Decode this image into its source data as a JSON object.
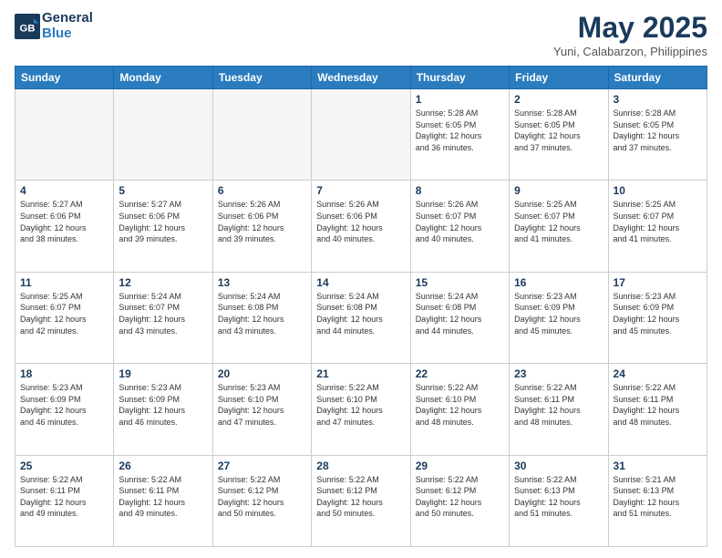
{
  "header": {
    "logo_line1": "General",
    "logo_line2": "Blue",
    "title": "May 2025",
    "subtitle": "Yuni, Calabarzon, Philippines"
  },
  "days_of_week": [
    "Sunday",
    "Monday",
    "Tuesday",
    "Wednesday",
    "Thursday",
    "Friday",
    "Saturday"
  ],
  "weeks": [
    [
      {
        "day": "",
        "info": ""
      },
      {
        "day": "",
        "info": ""
      },
      {
        "day": "",
        "info": ""
      },
      {
        "day": "",
        "info": ""
      },
      {
        "day": "1",
        "info": "Sunrise: 5:28 AM\nSunset: 6:05 PM\nDaylight: 12 hours\nand 36 minutes."
      },
      {
        "day": "2",
        "info": "Sunrise: 5:28 AM\nSunset: 6:05 PM\nDaylight: 12 hours\nand 37 minutes."
      },
      {
        "day": "3",
        "info": "Sunrise: 5:28 AM\nSunset: 6:05 PM\nDaylight: 12 hours\nand 37 minutes."
      }
    ],
    [
      {
        "day": "4",
        "info": "Sunrise: 5:27 AM\nSunset: 6:06 PM\nDaylight: 12 hours\nand 38 minutes."
      },
      {
        "day": "5",
        "info": "Sunrise: 5:27 AM\nSunset: 6:06 PM\nDaylight: 12 hours\nand 39 minutes."
      },
      {
        "day": "6",
        "info": "Sunrise: 5:26 AM\nSunset: 6:06 PM\nDaylight: 12 hours\nand 39 minutes."
      },
      {
        "day": "7",
        "info": "Sunrise: 5:26 AM\nSunset: 6:06 PM\nDaylight: 12 hours\nand 40 minutes."
      },
      {
        "day": "8",
        "info": "Sunrise: 5:26 AM\nSunset: 6:07 PM\nDaylight: 12 hours\nand 40 minutes."
      },
      {
        "day": "9",
        "info": "Sunrise: 5:25 AM\nSunset: 6:07 PM\nDaylight: 12 hours\nand 41 minutes."
      },
      {
        "day": "10",
        "info": "Sunrise: 5:25 AM\nSunset: 6:07 PM\nDaylight: 12 hours\nand 41 minutes."
      }
    ],
    [
      {
        "day": "11",
        "info": "Sunrise: 5:25 AM\nSunset: 6:07 PM\nDaylight: 12 hours\nand 42 minutes."
      },
      {
        "day": "12",
        "info": "Sunrise: 5:24 AM\nSunset: 6:07 PM\nDaylight: 12 hours\nand 43 minutes."
      },
      {
        "day": "13",
        "info": "Sunrise: 5:24 AM\nSunset: 6:08 PM\nDaylight: 12 hours\nand 43 minutes."
      },
      {
        "day": "14",
        "info": "Sunrise: 5:24 AM\nSunset: 6:08 PM\nDaylight: 12 hours\nand 44 minutes."
      },
      {
        "day": "15",
        "info": "Sunrise: 5:24 AM\nSunset: 6:08 PM\nDaylight: 12 hours\nand 44 minutes."
      },
      {
        "day": "16",
        "info": "Sunrise: 5:23 AM\nSunset: 6:09 PM\nDaylight: 12 hours\nand 45 minutes."
      },
      {
        "day": "17",
        "info": "Sunrise: 5:23 AM\nSunset: 6:09 PM\nDaylight: 12 hours\nand 45 minutes."
      }
    ],
    [
      {
        "day": "18",
        "info": "Sunrise: 5:23 AM\nSunset: 6:09 PM\nDaylight: 12 hours\nand 46 minutes."
      },
      {
        "day": "19",
        "info": "Sunrise: 5:23 AM\nSunset: 6:09 PM\nDaylight: 12 hours\nand 46 minutes."
      },
      {
        "day": "20",
        "info": "Sunrise: 5:23 AM\nSunset: 6:10 PM\nDaylight: 12 hours\nand 47 minutes."
      },
      {
        "day": "21",
        "info": "Sunrise: 5:22 AM\nSunset: 6:10 PM\nDaylight: 12 hours\nand 47 minutes."
      },
      {
        "day": "22",
        "info": "Sunrise: 5:22 AM\nSunset: 6:10 PM\nDaylight: 12 hours\nand 48 minutes."
      },
      {
        "day": "23",
        "info": "Sunrise: 5:22 AM\nSunset: 6:11 PM\nDaylight: 12 hours\nand 48 minutes."
      },
      {
        "day": "24",
        "info": "Sunrise: 5:22 AM\nSunset: 6:11 PM\nDaylight: 12 hours\nand 48 minutes."
      }
    ],
    [
      {
        "day": "25",
        "info": "Sunrise: 5:22 AM\nSunset: 6:11 PM\nDaylight: 12 hours\nand 49 minutes."
      },
      {
        "day": "26",
        "info": "Sunrise: 5:22 AM\nSunset: 6:11 PM\nDaylight: 12 hours\nand 49 minutes."
      },
      {
        "day": "27",
        "info": "Sunrise: 5:22 AM\nSunset: 6:12 PM\nDaylight: 12 hours\nand 50 minutes."
      },
      {
        "day": "28",
        "info": "Sunrise: 5:22 AM\nSunset: 6:12 PM\nDaylight: 12 hours\nand 50 minutes."
      },
      {
        "day": "29",
        "info": "Sunrise: 5:22 AM\nSunset: 6:12 PM\nDaylight: 12 hours\nand 50 minutes."
      },
      {
        "day": "30",
        "info": "Sunrise: 5:22 AM\nSunset: 6:13 PM\nDaylight: 12 hours\nand 51 minutes."
      },
      {
        "day": "31",
        "info": "Sunrise: 5:21 AM\nSunset: 6:13 PM\nDaylight: 12 hours\nand 51 minutes."
      }
    ]
  ]
}
